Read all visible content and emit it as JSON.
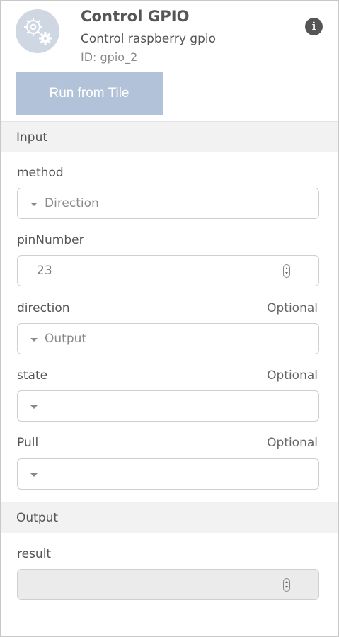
{
  "tile": {
    "title": "Control GPIO",
    "subtitle": "Control raspberry gpio",
    "id": "ID: gpio_2",
    "run_label": "Run from Tile",
    "info_glyph": "i"
  },
  "input": {
    "header": "Input",
    "optional_label": "Optional",
    "fields": {
      "method": {
        "label": "method",
        "value": "Direction"
      },
      "pinNumber": {
        "label": "pinNumber",
        "value": "23"
      },
      "direction": {
        "label": "direction",
        "value": "Output"
      },
      "state": {
        "label": "state",
        "value": ""
      },
      "pull": {
        "label": "Pull",
        "value": ""
      }
    }
  },
  "output": {
    "header": "Output",
    "fields": {
      "result": {
        "label": "result",
        "value": ""
      }
    }
  },
  "colors": {
    "run_button": "#b2c3d9",
    "icon_bg": "#cfd7e3",
    "section_bg": "#f2f2f2"
  },
  "icons": [
    "gears-icon",
    "info-icon",
    "chevron-down-icon",
    "spinner-icon"
  ]
}
